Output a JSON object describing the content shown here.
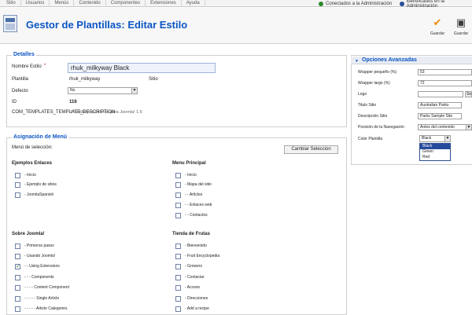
{
  "top_menu": [
    "Sitio",
    "Usuarios",
    "Menús",
    "Contenido",
    "Componentes",
    "Extensiones",
    "Ayuda"
  ],
  "status": {
    "admin_text": "Conectados a la Administración",
    "admin_right_text": "Identificados en la Administración"
  },
  "toolbar": {
    "title": "Gestor de Plantillas: Editar Estilo",
    "save_label": "Guardar",
    "save_all_label": "Guardar"
  },
  "detalles": {
    "legend": "Detalles",
    "nombre_label": "Nombre Estilo",
    "nombre_required": "*",
    "nombre_value": "rhuk_milkyway Black",
    "plantilla_label": "Plantilla",
    "plantilla_value": "rhuk_milkyway",
    "plantilla_suffix": "Sitio",
    "defecto_label": "Defecto",
    "defecto_value": "No",
    "id_label": "ID",
    "id_value": "116",
    "description_key": "COM_TEMPLATES_TEMPLATE_DESCRIPTION",
    "description_value": "Plantilla por defecto para Joomla! 1.6"
  },
  "asignacion": {
    "legend": "Asignación de Menú",
    "seleccion_label": "Menú de selección:",
    "cambiar_button": "Cambiar Seleccion",
    "groups": [
      {
        "title": "Ejemplos Enlaces",
        "items": [
          {
            "label": "- Inicio",
            "checked": false
          },
          {
            "label": "- Ejemplo de sitios",
            "checked": false
          },
          {
            "label": "- JoomlaSpanish",
            "checked": false
          }
        ]
      },
      {
        "title": "Menu Principal",
        "items": [
          {
            "label": "- Inicio",
            "checked": false
          },
          {
            "label": "- Mapa del sitio",
            "checked": false
          },
          {
            "label": "- - Articles",
            "checked": false
          },
          {
            "label": "- - Enlaces web",
            "checked": false
          },
          {
            "label": "- - Contactos",
            "checked": false
          }
        ]
      },
      {
        "title": "Sobre Joomla!",
        "items": [
          {
            "label": "- Primeros pasos",
            "checked": false
          },
          {
            "label": "- Usando Joomla!",
            "checked": false
          },
          {
            "label": "- - Using Extensions",
            "checked": true
          },
          {
            "label": "- - - Components",
            "checked": false
          },
          {
            "label": "- - - - Content Component",
            "checked": false
          },
          {
            "label": "- - - - - Single Article",
            "checked": false
          },
          {
            "label": "- - - - - Article Categories",
            "checked": false
          }
        ]
      },
      {
        "title": "Tienda de Frutas",
        "items": [
          {
            "label": "- Bienvenido",
            "checked": false
          },
          {
            "label": "- Fruit Encyclopedia",
            "checked": false
          },
          {
            "label": "- Growers",
            "checked": false
          },
          {
            "label": "- Contactar",
            "checked": false
          },
          {
            "label": "- Acceso",
            "checked": false
          },
          {
            "label": "- Direcciones",
            "checked": false
          },
          {
            "label": "- Add a recipe",
            "checked": false
          }
        ]
      }
    ]
  },
  "opciones": {
    "title": "Opciones Avanzadas",
    "wrapper_small_label": "Wrapper pequeño (%)",
    "wrapper_small_value": "53",
    "wrapper_large_label": "Wrapper largo (%)",
    "wrapper_large_value": "72",
    "logo_label": "Logo",
    "logo_value": "",
    "logo_button": "Se",
    "titulo_label": "Titulo Sitio",
    "titulo_value": "Australian Parks",
    "descripcion_label": "Descripción Sitio",
    "descripcion_value": "Parks Sample Site",
    "posicion_label": "Posición de la Navegación",
    "posicion_value": "Antes del contenido",
    "color_label": "Color Plantilla",
    "color_value": "Black",
    "color_options": [
      "Black",
      "Green",
      "Red"
    ],
    "color_selected": "Black"
  },
  "colors": {
    "accent": "#0b55c4",
    "input_bg": "#eef3fb",
    "selected_option": "#264a9c",
    "save_check": "#f08a00",
    "admin_dot": "#2b8a2b",
    "admin_right_dot": "#2a4f9b"
  },
  "icons": {
    "save": "checkmark-icon",
    "save_all": "floppy-disk-icon",
    "logo": "template-manager-icon",
    "admin_status": "users-online-icon",
    "expand": "triangle-down-icon"
  }
}
